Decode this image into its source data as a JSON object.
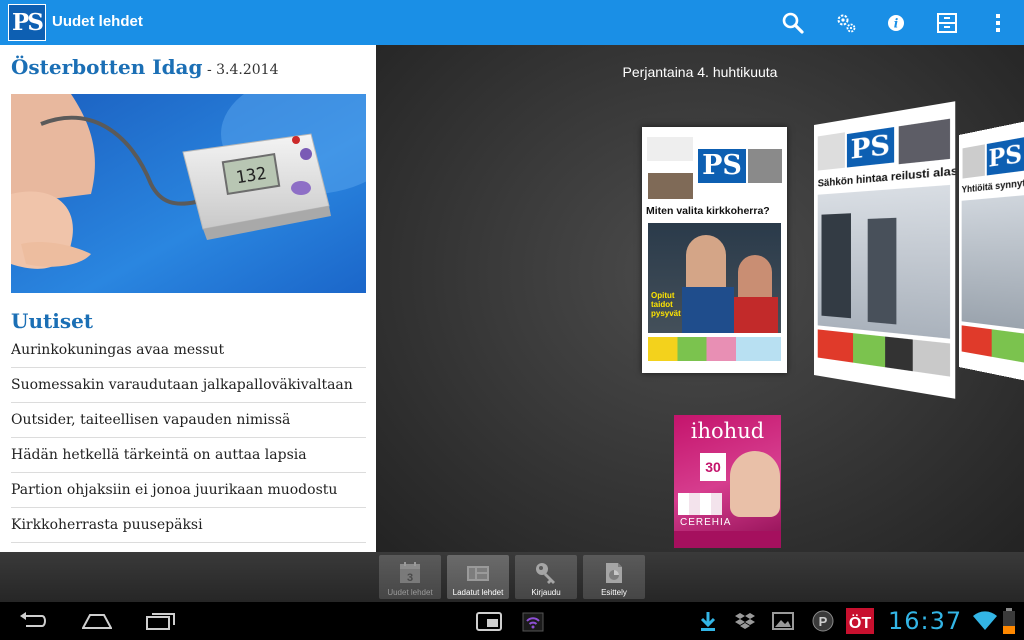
{
  "app": {
    "title": "Uudet lehdet",
    "logo_text": "PS"
  },
  "actionbar": {
    "icons": [
      "search-icon",
      "settings-icon",
      "info-icon",
      "archive-icon",
      "overflow-menu-icon"
    ]
  },
  "article": {
    "paper_name": "Österbotten Idag",
    "separator_date": " - 3.4.2014",
    "hero_display": "132",
    "section_title": "Uutiset",
    "news": [
      "Aurinkokuningas avaa messut",
      "Suomessakin varaudutaan jalkapalloväkivaltaan",
      "Outsider, taiteellisen vapauden nimissä",
      "Hädän hetkellä tärkeintä on auttaa lapsia",
      "Partion ohjaksiin ei jonoa juurikaan muodostu",
      "Kirkkoherrasta puusepäksi"
    ]
  },
  "carousel": {
    "date_heading": "Perjantaina 4. huhtikuuta",
    "covers": [
      {
        "masthead": "PS",
        "headline": "Miten valita kirkkoherra?",
        "subhead": "Opitut taidot pysyvät"
      },
      {
        "masthead": "PS",
        "headline": "Sähkön hintaa reilusti alas"
      },
      {
        "masthead": "PS",
        "headline": "Yhtiöitä synnytel"
      }
    ],
    "ad": {
      "title": "ihohud",
      "badge": "30",
      "brand": "CEREHIA"
    }
  },
  "toolbar": {
    "buttons": [
      {
        "label": "Uudet lehdet",
        "icon": "calendar-icon",
        "badge": "3"
      },
      {
        "label": "Ladatut lehdet",
        "icon": "downloaded-icon"
      },
      {
        "label": "Kirjaudu",
        "icon": "key-icon"
      },
      {
        "label": "Esittely",
        "icon": "intro-icon"
      }
    ]
  },
  "system": {
    "clock": "16:37",
    "accent": "#33b5e5",
    "actionbar_color": "#1a8fe6"
  }
}
